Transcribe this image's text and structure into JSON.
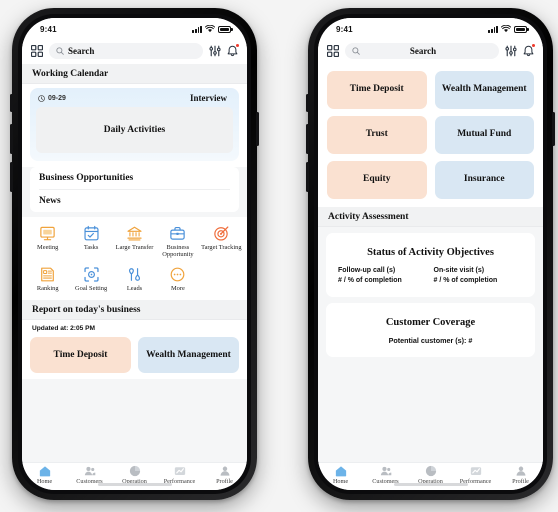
{
  "phones": [
    {
      "id": "left",
      "name": "home-screen",
      "status_bar": {
        "time": "9:41",
        "signal_icon": "cellular-bars-icon",
        "wifi_icon": "wifi-icon",
        "battery_icon": "battery-icon"
      },
      "header": {
        "scan_icon": "grid-scan-icon",
        "search_icon": "search-icon",
        "search_placeholder": "Search",
        "filter_icon": "sliders-filter-icon",
        "bell_icon": "bell-notification-icon"
      },
      "sections": {
        "calendar_title": "Working Calendar",
        "calendar": {
          "clock_icon": "clock-icon",
          "date": "09-29",
          "badge": "Interview",
          "inner_label": "Daily Activities"
        },
        "list": [
          "Business Opportunities",
          "News"
        ],
        "quick_actions": [
          {
            "label": "Meeting",
            "icon": "meeting-board-icon",
            "color": "#f0a33c"
          },
          {
            "label": "Tasks",
            "icon": "tasks-calendar-icon",
            "color": "#4a90d9"
          },
          {
            "label": "Large Transfer",
            "icon": "bank-transfer-icon",
            "color": "#f0a33c"
          },
          {
            "label": "Business Opportunity",
            "icon": "briefcase-icon",
            "color": "#4a90d9"
          },
          {
            "label": "Target Tracking",
            "icon": "target-icon",
            "color": "#ef6c3a"
          },
          {
            "label": "Ranking",
            "icon": "ranking-list-icon",
            "color": "#f0a33c"
          },
          {
            "label": "Goal Setting",
            "icon": "goal-scan-icon",
            "color": "#4a90d9"
          },
          {
            "label": "Leads",
            "icon": "leads-pins-icon",
            "color": "#4a90d9"
          },
          {
            "label": "More",
            "icon": "more-dots-icon",
            "color": "#f0a33c"
          }
        ],
        "report_title": "Report on today's business",
        "report": {
          "updated": "Updated at: 2:05 PM",
          "tiles": [
            {
              "label": "Time Deposit",
              "color": "#fae1d1"
            },
            {
              "label": "Wealth Management",
              "color": "#d9e7f3"
            }
          ]
        }
      },
      "tabs": [
        {
          "label": "Home",
          "icon": "home-icon",
          "active": true
        },
        {
          "label": "Customers",
          "icon": "customers-icon",
          "active": false
        },
        {
          "label": "Operation",
          "icon": "pie-chart-icon",
          "active": false
        },
        {
          "label": "Performance",
          "icon": "trend-chart-icon",
          "active": false
        },
        {
          "label": "Profile",
          "icon": "person-icon",
          "active": false
        }
      ]
    },
    {
      "id": "right",
      "name": "products-screen",
      "status_bar": {
        "time": "9:41",
        "signal_icon": "cellular-bars-icon",
        "wifi_icon": "wifi-icon",
        "battery_icon": "battery-icon"
      },
      "header": {
        "scan_icon": "grid-scan-icon",
        "search_icon": "search-icon",
        "search_placeholder": "Search",
        "filter_icon": "sliders-filter-icon",
        "bell_icon": "bell-notification-icon"
      },
      "products": [
        {
          "label": "Time Deposit",
          "color": "#fae1d1"
        },
        {
          "label": "Wealth Management",
          "color": "#d9e7f3"
        },
        {
          "label": "Trust",
          "color": "#fae1d1"
        },
        {
          "label": "Mutual Fund",
          "color": "#d9e7f3"
        },
        {
          "label": "Equity",
          "color": "#fae1d1"
        },
        {
          "label": "Insurance",
          "color": "#d9e7f3"
        }
      ],
      "assessment": {
        "title": "Activity Assessment",
        "objectives": {
          "heading": "Status of Activity Objectives",
          "metrics": [
            {
              "line1": "Follow-up call (s)",
              "line2": "# / % of completion"
            },
            {
              "line1": "On-site visit (s)",
              "line2": "# / % of completion"
            }
          ]
        },
        "coverage": {
          "heading": "Customer Coverage",
          "sub": "Potential customer (s): #"
        }
      },
      "tabs": [
        {
          "label": "Home",
          "icon": "home-icon",
          "active": true
        },
        {
          "label": "Customers",
          "icon": "customers-icon",
          "active": false
        },
        {
          "label": "Operation",
          "icon": "pie-chart-icon",
          "active": false
        },
        {
          "label": "Performance",
          "icon": "trend-chart-icon",
          "active": false
        },
        {
          "label": "Profile",
          "icon": "person-icon",
          "active": false
        }
      ]
    }
  ],
  "colors": {
    "accent_blue": "#4a90d9",
    "accent_orange": "#f0a33c",
    "peach": "#fae1d1",
    "pale_blue": "#d9e7f3",
    "alert_red": "#ef3b2d"
  }
}
